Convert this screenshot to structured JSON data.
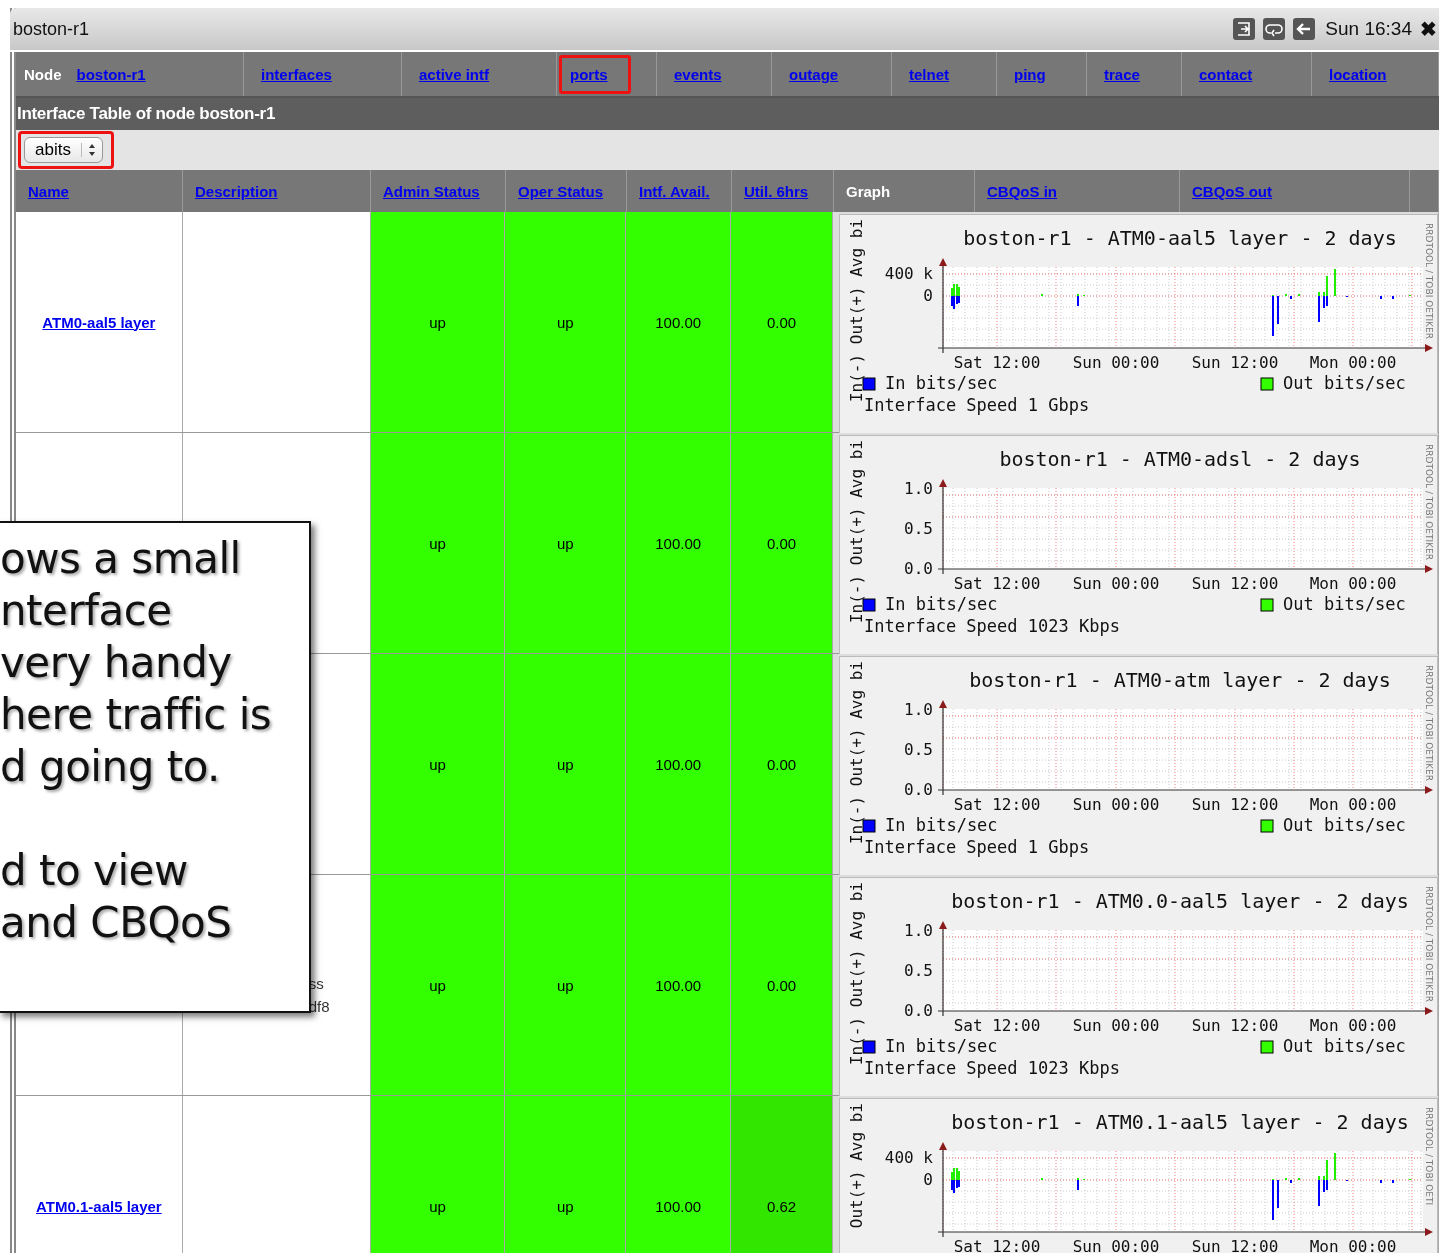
{
  "window": {
    "title": "boston-r1",
    "clock": "Sun 16:34",
    "close": "✖"
  },
  "nav": {
    "label": "Node",
    "items": [
      {
        "text": "boston-r1",
        "highlighted": false
      },
      {
        "text": "interfaces",
        "highlighted": false
      },
      {
        "text": "active intf",
        "highlighted": false
      },
      {
        "text": "ports",
        "highlighted": true
      },
      {
        "text": "events",
        "highlighted": false
      },
      {
        "text": "outage",
        "highlighted": false
      },
      {
        "text": "telnet",
        "highlighted": false
      },
      {
        "text": "ping",
        "highlighted": false
      },
      {
        "text": "trace",
        "highlighted": false
      },
      {
        "text": "contact",
        "highlighted": false
      },
      {
        "text": "location",
        "highlighted": false
      }
    ]
  },
  "section_title": "Interface Table of node boston-r1",
  "view_select": {
    "value": "abits",
    "highlighted": true
  },
  "columns": [
    {
      "text": "Name",
      "link": true
    },
    {
      "text": "Description",
      "link": true
    },
    {
      "text": "Admin Status",
      "link": true
    },
    {
      "text": "Oper Status",
      "link": true
    },
    {
      "text": "Intf. Avail.",
      "link": true
    },
    {
      "text": "Util. 6hrs",
      "link": true
    },
    {
      "text": "Graph",
      "link": false
    },
    {
      "text": "CBQoS in",
      "link": true
    },
    {
      "text": "CBQoS out",
      "link": true
    }
  ],
  "rows": [
    {
      "name": "ATM0-aal5 layer",
      "admin": {
        "text": "up",
        "color": "#33ff00"
      },
      "oper": {
        "text": "up",
        "color": "#33ff00"
      },
      "avail": {
        "text": "100.00",
        "color": "#33ff00"
      },
      "util": {
        "text": "0.00",
        "color": "#33ff00"
      },
      "graph": {
        "title": "boston-r1 - ATM0-aal5 layer - 2 days",
        "kind": "traffic",
        "y_labels": [
          "400 k",
          "0"
        ],
        "x_labels": [
          "Sat 12:00",
          "Sun 00:00",
          "Sun 12:00",
          "Mon 00:00"
        ],
        "axis_label": "In(-) Out(+) Avg bi",
        "in_legend": "In bits/sec",
        "out_legend": "Out bits/sec",
        "speed": "Interface Speed 1 Gbps",
        "side_text": "RRDTOOL / TOBI OETIKER"
      }
    },
    {
      "admin": {
        "text": "up",
        "color": "#33ff00"
      },
      "oper": {
        "text": "up",
        "color": "#33ff00"
      },
      "avail": {
        "text": "100.00",
        "color": "#33ff00"
      },
      "util": {
        "text": "0.00",
        "color": "#33ff00"
      },
      "graph": {
        "title": "boston-r1 - ATM0-adsl - 2 days",
        "kind": "flat",
        "y_labels": [
          "1.0",
          "0.5",
          "0.0"
        ],
        "x_labels": [
          "Sat 12:00",
          "Sun 00:00",
          "Sun 12:00",
          "Mon 00:00"
        ],
        "axis_label": "In(-) Out(+) Avg bi",
        "in_legend": "In bits/sec",
        "out_legend": "Out bits/sec",
        "speed": "Interface Speed 1023 Kbps",
        "side_text": "RRDTOOL / TOBI OETIKER"
      }
    },
    {
      "admin": {
        "text": "up",
        "color": "#33ff00"
      },
      "oper": {
        "text": "up",
        "color": "#33ff00"
      },
      "avail": {
        "text": "100.00",
        "color": "#33ff00"
      },
      "util": {
        "text": "0.00",
        "color": "#33ff00"
      },
      "graph": {
        "title": "boston-r1 - ATM0-atm layer - 2 days",
        "kind": "flat",
        "y_labels": [
          "1.0",
          "0.5",
          "0.0"
        ],
        "x_labels": [
          "Sat 12:00",
          "Sun 00:00",
          "Sun 12:00",
          "Mon 00:00"
        ],
        "axis_label": "In(-) Out(+) Avg bi",
        "in_legend": "In bits/sec",
        "out_legend": "Out bits/sec",
        "speed": "Interface Speed 1 Gbps",
        "side_text": "RRDTOOL / TOBI OETIKER"
      }
    },
    {
      "description": [
        "ss",
        "df8"
      ],
      "admin": {
        "text": "up",
        "color": "#33ff00"
      },
      "oper": {
        "text": "up",
        "color": "#33ff00"
      },
      "avail": {
        "text": "100.00",
        "color": "#33ff00"
      },
      "util": {
        "text": "0.00",
        "color": "#33ff00"
      },
      "graph": {
        "title": "boston-r1 - ATM0.0-aal5 layer - 2 days",
        "kind": "flat",
        "y_labels": [
          "1.0",
          "0.5",
          "0.0"
        ],
        "x_labels": [
          "Sat 12:00",
          "Sun 00:00",
          "Sun 12:00",
          "Mon 00:00"
        ],
        "axis_label": "In(-) Out(+) Avg bi",
        "in_legend": "In bits/sec",
        "out_legend": "Out bits/sec",
        "speed": "Interface Speed 1023 Kbps",
        "side_text": "RRDTOOL / TOBI OETIKER"
      }
    },
    {
      "name": "ATM0.1-aal5 layer",
      "admin": {
        "text": "up",
        "color": "#33ff00"
      },
      "oper": {
        "text": "up",
        "color": "#33ff00"
      },
      "avail": {
        "text": "100.00",
        "color": "#33ff00"
      },
      "util": {
        "text": "0.62",
        "color": "#33e600"
      },
      "graph": {
        "title": "boston-r1 - ATM0.1-aal5 layer - 2 days",
        "kind": "traffic",
        "y_labels": [
          "400 k",
          "0"
        ],
        "x_labels": [
          "Sat 12:00",
          "Sun 00:00",
          "Sun 12:00",
          "Mon 00:00"
        ],
        "axis_label": "Out(+) Avg bi",
        "side_text": "RRDTOOL / TOBI OETI"
      }
    }
  ],
  "callout": {
    "text": "ows a small\nnterface\nvery handy\nhere traffic is\nd going to.\n\nd to view\nand CBQoS"
  }
}
